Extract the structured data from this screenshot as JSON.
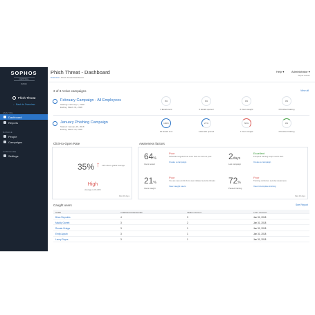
{
  "sidebar": {
    "brand": "SOPHOS",
    "brand_sub1": "CENTRAL",
    "brand_sub2": "Admin",
    "product": "Phish Threat",
    "back": "Back to Overview",
    "section_analyze": "ANALYZE",
    "section_manage": "MANAGE",
    "section_config": "CONFIGURE",
    "items": [
      {
        "label": "Dashboard",
        "icon": "dashboard-icon",
        "active": true
      },
      {
        "label": "Reports",
        "icon": "reports-icon",
        "active": false
      },
      {
        "label": "People",
        "icon": "people-icon",
        "active": false
      },
      {
        "label": "Campaigns",
        "icon": "campaigns-icon",
        "active": false
      },
      {
        "label": "Settings",
        "icon": "settings-icon",
        "active": false
      }
    ]
  },
  "header": {
    "title": "Phish Threat - Dashboard",
    "crumb_link": "Overview",
    "crumb_current": "Phish Threat Dashboard",
    "help": "Help ▾",
    "admin": "Administrator ▾",
    "admin_sub": "Super Admin"
  },
  "campaigns": {
    "heading": "3 of 3 Active campaigns",
    "view_all": "View all",
    "items": [
      {
        "name": "February Campaign - All Employees",
        "started": "Starting: February 1, 2018",
        "ending": "Ending: March 31, 2018",
        "metrics": [
          {
            "value": "0%",
            "label": "0 Emails sent",
            "style": "plain"
          },
          {
            "value": "0%",
            "label": "0 Emails opened",
            "style": "plain"
          },
          {
            "value": "0%",
            "label": "0 Users caught",
            "style": "plain"
          },
          {
            "value": "0%",
            "label": "0 Finished training",
            "style": "plain"
          }
        ]
      },
      {
        "name": "January Phishing Campaign",
        "started": "Started: January 15, 2018",
        "ending": "Ending: March 15, 2018",
        "metrics": [
          {
            "value": "100%",
            "label": "29 Emails sent",
            "style": "blue"
          },
          {
            "value": "27%",
            "label": "14 Emails opened",
            "style": "blue"
          },
          {
            "value": "50%",
            "label": "7 Users caught",
            "style": "red"
          },
          {
            "value": "0%",
            "label": "0 Finished training",
            "style": "green"
          }
        ]
      }
    ]
  },
  "click_to_open": {
    "heading": "Click-to-Open Rate",
    "value": "35%",
    "arrow": "↑",
    "note": "13% above global average",
    "level": "High",
    "level_note": "Average is 15-20%",
    "footer": "Past 30 days"
  },
  "awareness": {
    "heading": "Awareness factors",
    "footer": "Past 30 days",
    "items": [
      {
        "value": "64",
        "unit": "%",
        "label": "Users tested",
        "status": "Poor",
        "status_class": "poor",
        "desc": "Schedule targeted test more than six times a year",
        "link": "Create a campaign"
      },
      {
        "value": "2",
        "unit": "days",
        "label": "Last campaign",
        "status": "Excellent",
        "status_class": "excellent",
        "desc": "Frequent training keeps users alert",
        "link": "Create a campaign"
      },
      {
        "value": "21",
        "unit": "%",
        "label": "Users caught",
        "status": "Poor",
        "status_class": "poor",
        "desc": "You are very at risk from user-initiated security threats",
        "link": "View caught users"
      },
      {
        "value": "72",
        "unit": "%",
        "label": "Passed training",
        "status": "Poor",
        "status_class": "poor",
        "desc": "Training reinforces security awareness",
        "link": "View incomplete training"
      }
    ]
  },
  "caught_users": {
    "heading": "Caught users",
    "see_report": "See Report",
    "columns": [
      "NAME",
      "CAMPAIGNS RECEIVED",
      "TIMES CAUGHT",
      "LAST CAUGHT"
    ],
    "rows": [
      [
        "Brian Reynolds",
        "4",
        "3",
        "Jan 31, 2018"
      ],
      [
        "Maddy Garrett",
        "3",
        "2",
        "Jan 31, 2018"
      ],
      [
        "Renata Ortega",
        "3",
        "1",
        "Jan 31, 2018"
      ],
      [
        "Emily Appah",
        "3",
        "1",
        "Jan 31, 2018"
      ],
      [
        "Lacey Reyes",
        "3",
        "1",
        "Jan 31, 2018"
      ]
    ]
  }
}
